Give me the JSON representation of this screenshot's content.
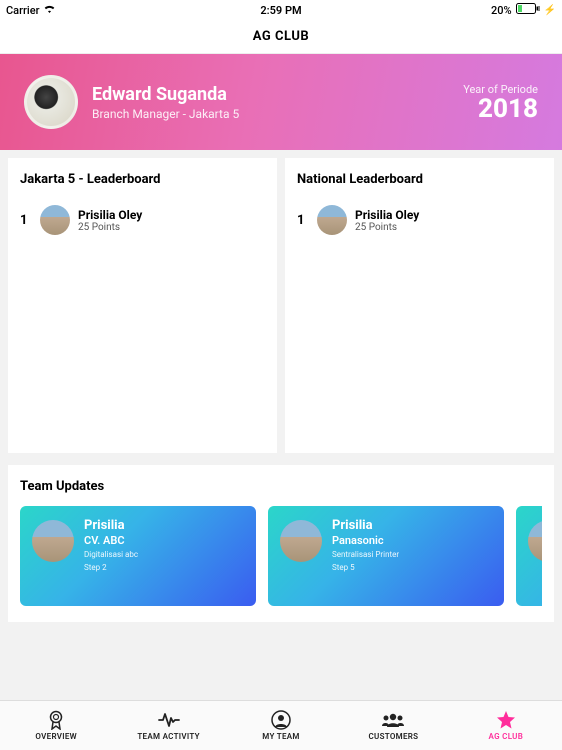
{
  "statusBar": {
    "carrier": "Carrier",
    "time": "2:59 PM",
    "battery": "20%"
  },
  "navTitle": "AG CLUB",
  "header": {
    "name": "Edward Suganda",
    "role": "Branch Manager - Jakarta 5",
    "yearLabel": "Year of Periode",
    "yearValue": "2018"
  },
  "leaderboards": [
    {
      "title": "Jakarta 5 - Leaderboard",
      "entries": [
        {
          "rank": "1",
          "name": "Prisilia Oley",
          "points": "25 Points"
        }
      ]
    },
    {
      "title": "National Leaderboard",
      "entries": [
        {
          "rank": "1",
          "name": "Prisilia Oley",
          "points": "25 Points"
        }
      ]
    }
  ],
  "teamUpdates": {
    "title": "Team Updates",
    "cards": [
      {
        "name": "Prisilia",
        "company": "CV. ABC",
        "detail": "Digitalisasi\nabc",
        "step": "Step 2"
      },
      {
        "name": "Prisilia",
        "company": "Panasonic",
        "detail": "Sentralisasi\nPrinter",
        "step": "Step 5"
      },
      {
        "name": "",
        "company": "",
        "detail": "",
        "step": ""
      }
    ]
  },
  "tabs": [
    {
      "label": "OVERVIEW",
      "icon": "ribbon-icon",
      "active": false
    },
    {
      "label": "TEAM ACTIVITY",
      "icon": "activity-icon",
      "active": false
    },
    {
      "label": "MY TEAM",
      "icon": "person-circle-icon",
      "active": false
    },
    {
      "label": "CUSTOMERS",
      "icon": "people-icon",
      "active": false
    },
    {
      "label": "AG CLUB",
      "icon": "star-icon",
      "active": true
    }
  ]
}
